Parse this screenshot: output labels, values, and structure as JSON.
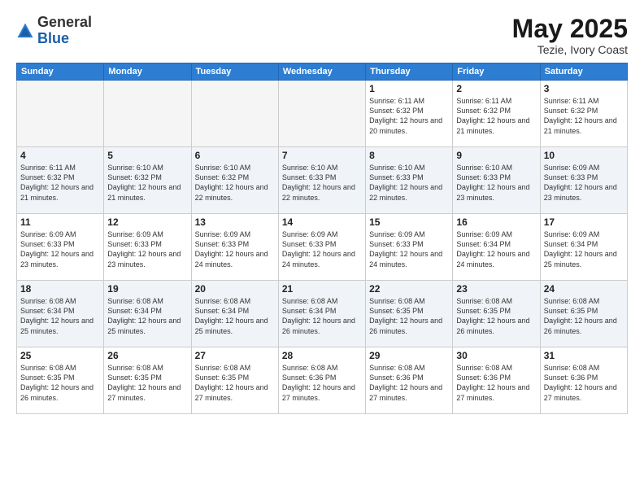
{
  "header": {
    "logo_general": "General",
    "logo_blue": "Blue",
    "main_title": "May 2025",
    "subtitle": "Tezie, Ivory Coast"
  },
  "calendar": {
    "days_of_week": [
      "Sunday",
      "Monday",
      "Tuesday",
      "Wednesday",
      "Thursday",
      "Friday",
      "Saturday"
    ],
    "weeks": [
      {
        "days": [
          {
            "number": "",
            "info": "",
            "empty": true
          },
          {
            "number": "",
            "info": "",
            "empty": true
          },
          {
            "number": "",
            "info": "",
            "empty": true
          },
          {
            "number": "",
            "info": "",
            "empty": true
          },
          {
            "number": "1",
            "info": "Sunrise: 6:11 AM\nSunset: 6:32 PM\nDaylight: 12 hours\nand 20 minutes.",
            "empty": false
          },
          {
            "number": "2",
            "info": "Sunrise: 6:11 AM\nSunset: 6:32 PM\nDaylight: 12 hours\nand 21 minutes.",
            "empty": false
          },
          {
            "number": "3",
            "info": "Sunrise: 6:11 AM\nSunset: 6:32 PM\nDaylight: 12 hours\nand 21 minutes.",
            "empty": false
          }
        ]
      },
      {
        "days": [
          {
            "number": "4",
            "info": "Sunrise: 6:11 AM\nSunset: 6:32 PM\nDaylight: 12 hours\nand 21 minutes.",
            "empty": false
          },
          {
            "number": "5",
            "info": "Sunrise: 6:10 AM\nSunset: 6:32 PM\nDaylight: 12 hours\nand 21 minutes.",
            "empty": false
          },
          {
            "number": "6",
            "info": "Sunrise: 6:10 AM\nSunset: 6:32 PM\nDaylight: 12 hours\nand 22 minutes.",
            "empty": false
          },
          {
            "number": "7",
            "info": "Sunrise: 6:10 AM\nSunset: 6:33 PM\nDaylight: 12 hours\nand 22 minutes.",
            "empty": false
          },
          {
            "number": "8",
            "info": "Sunrise: 6:10 AM\nSunset: 6:33 PM\nDaylight: 12 hours\nand 22 minutes.",
            "empty": false
          },
          {
            "number": "9",
            "info": "Sunrise: 6:10 AM\nSunset: 6:33 PM\nDaylight: 12 hours\nand 23 minutes.",
            "empty": false
          },
          {
            "number": "10",
            "info": "Sunrise: 6:09 AM\nSunset: 6:33 PM\nDaylight: 12 hours\nand 23 minutes.",
            "empty": false
          }
        ]
      },
      {
        "days": [
          {
            "number": "11",
            "info": "Sunrise: 6:09 AM\nSunset: 6:33 PM\nDaylight: 12 hours\nand 23 minutes.",
            "empty": false
          },
          {
            "number": "12",
            "info": "Sunrise: 6:09 AM\nSunset: 6:33 PM\nDaylight: 12 hours\nand 23 minutes.",
            "empty": false
          },
          {
            "number": "13",
            "info": "Sunrise: 6:09 AM\nSunset: 6:33 PM\nDaylight: 12 hours\nand 24 minutes.",
            "empty": false
          },
          {
            "number": "14",
            "info": "Sunrise: 6:09 AM\nSunset: 6:33 PM\nDaylight: 12 hours\nand 24 minutes.",
            "empty": false
          },
          {
            "number": "15",
            "info": "Sunrise: 6:09 AM\nSunset: 6:33 PM\nDaylight: 12 hours\nand 24 minutes.",
            "empty": false
          },
          {
            "number": "16",
            "info": "Sunrise: 6:09 AM\nSunset: 6:34 PM\nDaylight: 12 hours\nand 24 minutes.",
            "empty": false
          },
          {
            "number": "17",
            "info": "Sunrise: 6:09 AM\nSunset: 6:34 PM\nDaylight: 12 hours\nand 25 minutes.",
            "empty": false
          }
        ]
      },
      {
        "days": [
          {
            "number": "18",
            "info": "Sunrise: 6:08 AM\nSunset: 6:34 PM\nDaylight: 12 hours\nand 25 minutes.",
            "empty": false
          },
          {
            "number": "19",
            "info": "Sunrise: 6:08 AM\nSunset: 6:34 PM\nDaylight: 12 hours\nand 25 minutes.",
            "empty": false
          },
          {
            "number": "20",
            "info": "Sunrise: 6:08 AM\nSunset: 6:34 PM\nDaylight: 12 hours\nand 25 minutes.",
            "empty": false
          },
          {
            "number": "21",
            "info": "Sunrise: 6:08 AM\nSunset: 6:34 PM\nDaylight: 12 hours\nand 26 minutes.",
            "empty": false
          },
          {
            "number": "22",
            "info": "Sunrise: 6:08 AM\nSunset: 6:35 PM\nDaylight: 12 hours\nand 26 minutes.",
            "empty": false
          },
          {
            "number": "23",
            "info": "Sunrise: 6:08 AM\nSunset: 6:35 PM\nDaylight: 12 hours\nand 26 minutes.",
            "empty": false
          },
          {
            "number": "24",
            "info": "Sunrise: 6:08 AM\nSunset: 6:35 PM\nDaylight: 12 hours\nand 26 minutes.",
            "empty": false
          }
        ]
      },
      {
        "days": [
          {
            "number": "25",
            "info": "Sunrise: 6:08 AM\nSunset: 6:35 PM\nDaylight: 12 hours\nand 26 minutes.",
            "empty": false
          },
          {
            "number": "26",
            "info": "Sunrise: 6:08 AM\nSunset: 6:35 PM\nDaylight: 12 hours\nand 27 minutes.",
            "empty": false
          },
          {
            "number": "27",
            "info": "Sunrise: 6:08 AM\nSunset: 6:35 PM\nDaylight: 12 hours\nand 27 minutes.",
            "empty": false
          },
          {
            "number": "28",
            "info": "Sunrise: 6:08 AM\nSunset: 6:36 PM\nDaylight: 12 hours\nand 27 minutes.",
            "empty": false
          },
          {
            "number": "29",
            "info": "Sunrise: 6:08 AM\nSunset: 6:36 PM\nDaylight: 12 hours\nand 27 minutes.",
            "empty": false
          },
          {
            "number": "30",
            "info": "Sunrise: 6:08 AM\nSunset: 6:36 PM\nDaylight: 12 hours\nand 27 minutes.",
            "empty": false
          },
          {
            "number": "31",
            "info": "Sunrise: 6:08 AM\nSunset: 6:36 PM\nDaylight: 12 hours\nand 27 minutes.",
            "empty": false
          }
        ]
      }
    ]
  }
}
